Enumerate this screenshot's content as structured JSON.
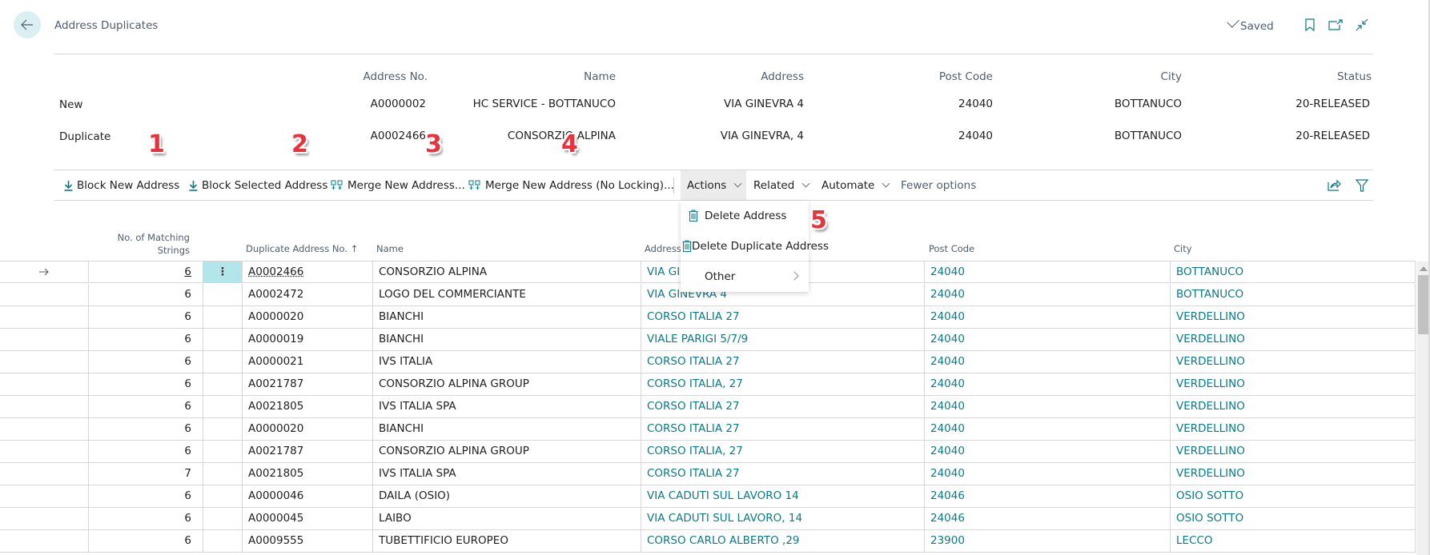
{
  "page": {
    "title": "Address Duplicates",
    "saved_label": "Saved"
  },
  "header": {
    "columns": [
      "Address No.",
      "Name",
      "Address",
      "Post Code",
      "City",
      "Status"
    ],
    "rows": [
      {
        "label": "New",
        "address_no": "A0000002",
        "name": "HC SERVICE - BOTTANUCO",
        "address": "VIA GINEVRA 4",
        "post_code": "24040",
        "city": "BOTTANUCO",
        "status": "20-RELEASED"
      },
      {
        "label": "Duplicate",
        "address_no": "A0002466",
        "name": "CONSORZIO ALPINA",
        "address": "VIA GINEVRA, 4",
        "post_code": "24040",
        "city": "BOTTANUCO",
        "status": "20-RELEASED"
      }
    ]
  },
  "toolbar": {
    "block_new": "Block New Address",
    "block_selected": "Block Selected Address",
    "merge_new": "Merge New Address...",
    "merge_no_lock": "Merge New Address (No Locking)...",
    "actions": "Actions",
    "related": "Related",
    "automate": "Automate",
    "fewer_options": "Fewer options"
  },
  "actions_menu": {
    "items": [
      "Delete Address",
      "Delete Duplicate Address",
      "Other"
    ]
  },
  "annotations": [
    "1",
    "2",
    "3",
    "4",
    "5"
  ],
  "list": {
    "columns": {
      "matching_line1": "No. of Matching",
      "matching_line2": "Strings",
      "dup_no": "Duplicate Address No. ↑",
      "name": "Name",
      "address": "Address",
      "post_code": "Post Code",
      "city": "City"
    },
    "rows": [
      {
        "matching": "6",
        "dup_no": "A0002466",
        "name": "CONSORZIO ALPINA",
        "address": "VIA GINEVRA, 4",
        "post_code": "24040",
        "city": "BOTTANUCO"
      },
      {
        "matching": "6",
        "dup_no": "A0002472",
        "name": "LOGO DEL COMMERCIANTE",
        "address": "VIA GINEVRA 4",
        "post_code": "24040",
        "city": "BOTTANUCO"
      },
      {
        "matching": "6",
        "dup_no": "A0000020",
        "name": "BIANCHI",
        "address": "CORSO ITALIA 27",
        "post_code": "24040",
        "city": "VERDELLINO"
      },
      {
        "matching": "6",
        "dup_no": "A0000019",
        "name": "BIANCHI",
        "address": "VIALE PARIGI 5/7/9",
        "post_code": "24040",
        "city": "VERDELLINO"
      },
      {
        "matching": "6",
        "dup_no": "A0000021",
        "name": "IVS ITALIA",
        "address": "CORSO ITALIA 27",
        "post_code": "24040",
        "city": "VERDELLINO"
      },
      {
        "matching": "6",
        "dup_no": "A0021787",
        "name": "CONSORZIO ALPINA GROUP",
        "address": "CORSO ITALIA, 27",
        "post_code": "24040",
        "city": "VERDELLINO"
      },
      {
        "matching": "6",
        "dup_no": "A0021805",
        "name": "IVS ITALIA SPA",
        "address": "CORSO ITALIA 27",
        "post_code": "24040",
        "city": "VERDELLINO"
      },
      {
        "matching": "6",
        "dup_no": "A0000020",
        "name": "BIANCHI",
        "address": "CORSO ITALIA 27",
        "post_code": "24040",
        "city": "VERDELLINO"
      },
      {
        "matching": "6",
        "dup_no": "A0021787",
        "name": "CONSORZIO ALPINA GROUP",
        "address": "CORSO ITALIA, 27",
        "post_code": "24040",
        "city": "VERDELLINO"
      },
      {
        "matching": "7",
        "dup_no": "A0021805",
        "name": "IVS ITALIA SPA",
        "address": "CORSO ITALIA 27",
        "post_code": "24040",
        "city": "VERDELLINO"
      },
      {
        "matching": "6",
        "dup_no": "A0000046",
        "name": "DAILA (OSIO)",
        "address": "VIA CADUTI SUL LAVORO 14",
        "post_code": "24046",
        "city": "OSIO SOTTO"
      },
      {
        "matching": "6",
        "dup_no": "A0000045",
        "name": "LAIBO",
        "address": "VIA CADUTI SUL LAVORO, 14",
        "post_code": "24046",
        "city": "OSIO SOTTO"
      },
      {
        "matching": "6",
        "dup_no": "A0009555",
        "name": "TUBETTIFICIO EUROPEO",
        "address": "CORSO CARLO ALBERTO ,29",
        "post_code": "23900",
        "city": "LECCO"
      }
    ]
  },
  "colors": {
    "accent": "#0b7a86",
    "selected_cell": "#b3e6ea",
    "back_button_bg": "#daeff1",
    "annotation_red": "#e8323c"
  }
}
